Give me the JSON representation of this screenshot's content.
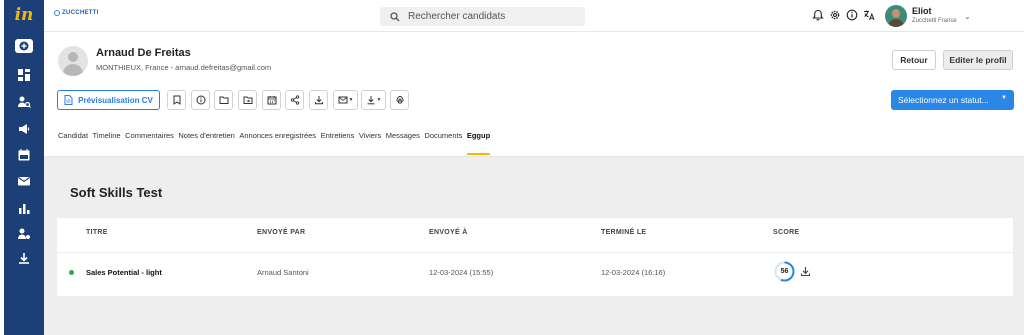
{
  "app": {
    "logo": "in",
    "brand": "ZUCCHETTI"
  },
  "sidebar": {
    "items": [
      {
        "name": "add-icon"
      },
      {
        "name": "dashboard-icon"
      },
      {
        "name": "candidates-icon"
      },
      {
        "name": "campaigns-icon"
      },
      {
        "name": "calendar-icon"
      },
      {
        "name": "mail-icon"
      },
      {
        "name": "statistics-icon"
      },
      {
        "name": "user-settings-icon"
      },
      {
        "name": "download-icon"
      }
    ]
  },
  "header": {
    "search_placeholder": "Rechercher candidats",
    "icons": [
      "bell-icon",
      "gear-icon",
      "info-icon",
      "translate-icon"
    ],
    "user": {
      "name": "Eliot",
      "org": "Zucchetti France"
    }
  },
  "candidate": {
    "name": "Arnaud De Freitas",
    "subtitle": "MONTHIEUX, France - arnaud.defreitas@gmail.com"
  },
  "actions": {
    "retour": "Retour",
    "edit_profile": "Editer le profil",
    "preview_cv": "Prévisualisation CV",
    "status_select": "Sélectionnez un statut...",
    "tools": [
      "bookmark-icon",
      "info-icon",
      "folder-icon",
      "folder-move-icon",
      "calendar-icon",
      "share-icon",
      "download-icon",
      "mail-icon",
      "export-icon",
      "fingerprint-icon"
    ]
  },
  "tabs": [
    {
      "label": "Candidat",
      "active": false
    },
    {
      "label": "Timeline",
      "active": false
    },
    {
      "label": "Commentaires",
      "active": false
    },
    {
      "label": "Notes d'entretien",
      "active": false
    },
    {
      "label": "Annonces enregistrées",
      "active": false
    },
    {
      "label": "Entretiens",
      "active": false
    },
    {
      "label": "Viviers",
      "active": false
    },
    {
      "label": "Messages",
      "active": false
    },
    {
      "label": "Documents",
      "active": false
    },
    {
      "label": "Eggup",
      "active": true
    }
  ],
  "main": {
    "section_title": "Soft Skills Test",
    "table": {
      "headers": {
        "titre": "TITRE",
        "envoye_par": "ENVOYÉ PAR",
        "envoye_a": "ENVOYÉ À",
        "termine_le": "TERMINÉ LE",
        "score": "SCORE"
      },
      "rows": [
        {
          "status_color": "#2eaa3a",
          "titre": "Sales Potential - light",
          "envoye_par": "Arnaud Santoni",
          "envoye_a": "12-03-2024 (15:55)",
          "termine_le": "12-03-2024 (16:16)",
          "score": "56",
          "score_fraction": 0.56
        }
      ]
    }
  },
  "colors": {
    "sidebar": "#1c3f77",
    "accent": "#2a87e6",
    "active_tab": "#f3b800",
    "panel": "#eeeeef"
  }
}
